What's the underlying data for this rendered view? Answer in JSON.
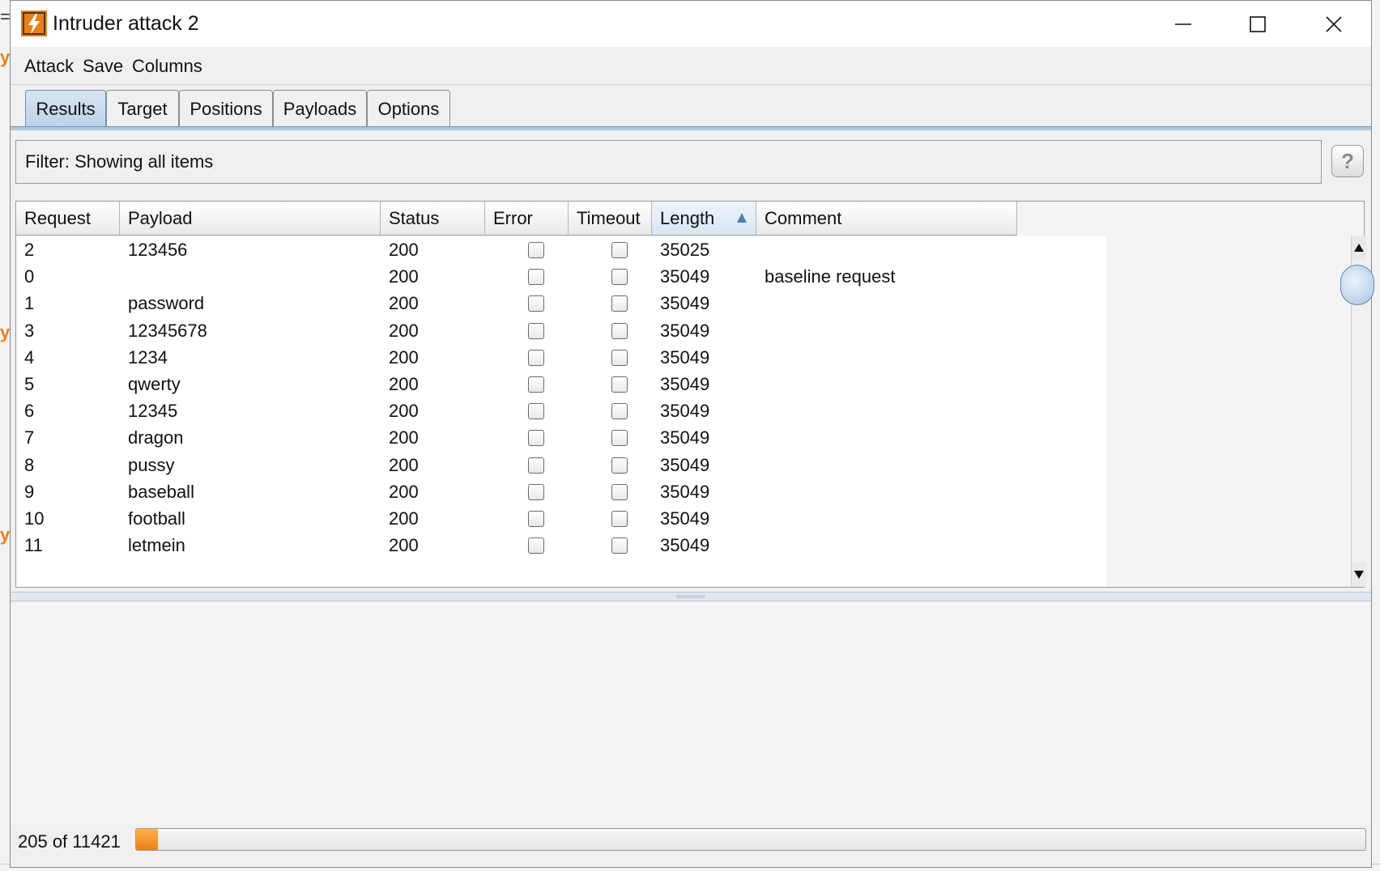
{
  "window": {
    "title": "Intruder attack 2",
    "icon": "burp-lightning-icon",
    "accent_color": "#e8801b"
  },
  "menu": [
    "Attack",
    "Save",
    "Columns"
  ],
  "tabs": [
    {
      "label": "Results",
      "active": true
    },
    {
      "label": "Target",
      "active": false
    },
    {
      "label": "Positions",
      "active": false
    },
    {
      "label": "Payloads",
      "active": false
    },
    {
      "label": "Options",
      "active": false
    }
  ],
  "filter": {
    "text": "Filter:  Showing all items",
    "help_label": "?"
  },
  "table": {
    "columns": [
      "Request",
      "Payload",
      "Status",
      "Error",
      "Timeout",
      "Length",
      "Comment"
    ],
    "sorted_column": "Length",
    "sort_direction": "ascending",
    "rows": [
      {
        "request": "2",
        "payload": "123456",
        "status": "200",
        "error": false,
        "timeout": false,
        "length": "35025",
        "comment": ""
      },
      {
        "request": "0",
        "payload": "",
        "status": "200",
        "error": false,
        "timeout": false,
        "length": "35049",
        "comment": "baseline request"
      },
      {
        "request": "1",
        "payload": "password",
        "status": "200",
        "error": false,
        "timeout": false,
        "length": "35049",
        "comment": ""
      },
      {
        "request": "3",
        "payload": "12345678",
        "status": "200",
        "error": false,
        "timeout": false,
        "length": "35049",
        "comment": ""
      },
      {
        "request": "4",
        "payload": "1234",
        "status": "200",
        "error": false,
        "timeout": false,
        "length": "35049",
        "comment": ""
      },
      {
        "request": "5",
        "payload": "qwerty",
        "status": "200",
        "error": false,
        "timeout": false,
        "length": "35049",
        "comment": ""
      },
      {
        "request": "6",
        "payload": "12345",
        "status": "200",
        "error": false,
        "timeout": false,
        "length": "35049",
        "comment": ""
      },
      {
        "request": "7",
        "payload": "dragon",
        "status": "200",
        "error": false,
        "timeout": false,
        "length": "35049",
        "comment": ""
      },
      {
        "request": "8",
        "payload": "pussy",
        "status": "200",
        "error": false,
        "timeout": false,
        "length": "35049",
        "comment": ""
      },
      {
        "request": "9",
        "payload": "baseball",
        "status": "200",
        "error": false,
        "timeout": false,
        "length": "35049",
        "comment": ""
      },
      {
        "request": "10",
        "payload": "football",
        "status": "200",
        "error": false,
        "timeout": false,
        "length": "35049",
        "comment": ""
      },
      {
        "request": "11",
        "payload": "letmein",
        "status": "200",
        "error": false,
        "timeout": false,
        "length": "35049",
        "comment": ""
      }
    ]
  },
  "progress": {
    "label": "205 of 11421",
    "fraction": 0.018
  }
}
